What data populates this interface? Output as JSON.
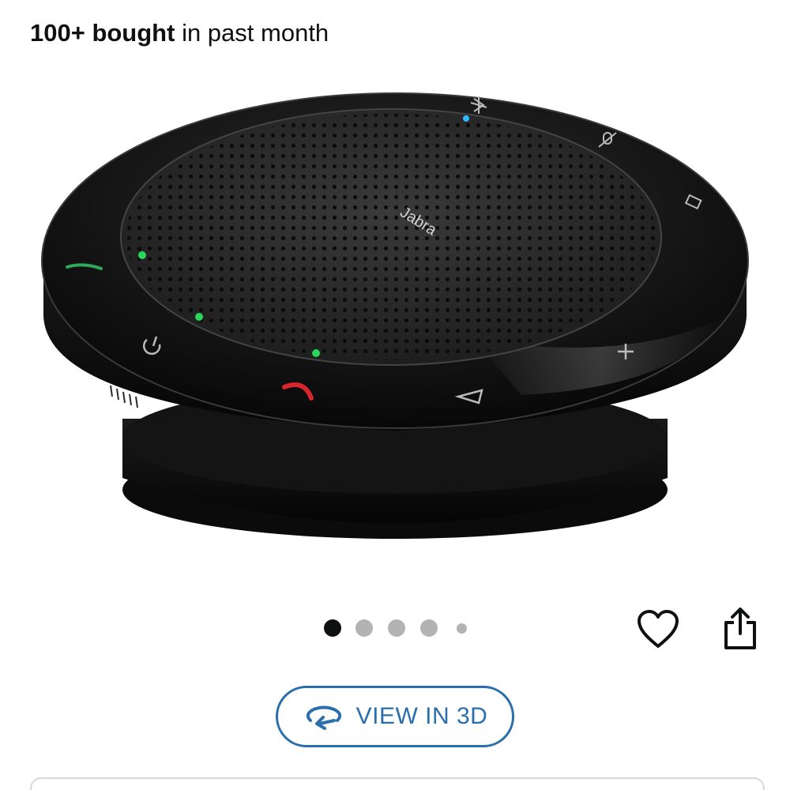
{
  "bought_badge": {
    "count": "100+ bought",
    "suffix": " in past month"
  },
  "product_image": {
    "brand_text": "Jabra",
    "alt": "Jabra speakerphone"
  },
  "carousel": {
    "image_count": 5,
    "active_index": 0
  },
  "actions": {
    "favorite_icon": "heart-icon",
    "share_icon": "share-icon"
  },
  "view_3d": {
    "label": "VIEW IN 3D",
    "icon": "rotate-3d-icon"
  },
  "colors": {
    "accent_blue": "#2a6fab",
    "text": "#0f1111",
    "dot_inactive": "#b3b3b3",
    "card_border": "#d5d9d9"
  }
}
